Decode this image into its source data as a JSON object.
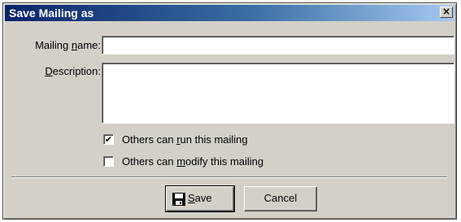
{
  "window": {
    "title": "Save Mailing as",
    "close_symbol": "×"
  },
  "form": {
    "mailing_name": {
      "label_pre": "Mailing ",
      "label_mnemonic": "n",
      "label_post": "ame:",
      "value": ""
    },
    "description": {
      "label_pre": "",
      "label_mnemonic": "D",
      "label_post": "escription:",
      "value": ""
    }
  },
  "options": {
    "run": {
      "label_pre": "Others can ",
      "label_mnemonic": "r",
      "label_post": "un this mailing",
      "checked": true,
      "check_glyph": "✔"
    },
    "modify": {
      "label_pre": "Others can ",
      "label_mnemonic": "m",
      "label_post": "odify this mailing",
      "checked": false,
      "check_glyph": ""
    }
  },
  "buttons": {
    "save": {
      "label_mnemonic": "S",
      "label_post": "ave",
      "icon": "floppy-disk-icon"
    },
    "cancel": {
      "label": "Cancel"
    }
  },
  "colors": {
    "title_bar_start": "#0a246a",
    "title_bar_end": "#a6caf0",
    "dialog_face": "#d4d0c8"
  }
}
